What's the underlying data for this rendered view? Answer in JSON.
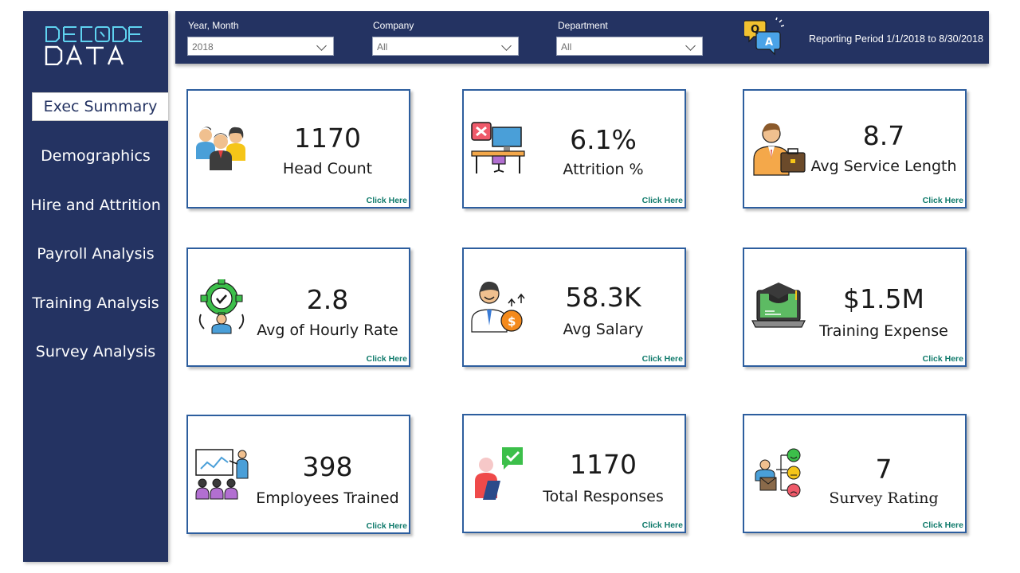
{
  "brand": {
    "logo_text_top": "DECODE",
    "logo_text_bottom": "DATA"
  },
  "sidebar": {
    "items": [
      {
        "label": "Exec Summary",
        "active": true
      },
      {
        "label": "Demographics"
      },
      {
        "label": "Hire and Attrition"
      },
      {
        "label": "Payroll Analysis"
      },
      {
        "label": "Training Analysis"
      },
      {
        "label": "Survey Analysis"
      }
    ]
  },
  "filters": {
    "year_month": {
      "label": "Year, Month",
      "value": "2018"
    },
    "company": {
      "label": "Company",
      "value": "All"
    },
    "department": {
      "label": "Department",
      "value": "All"
    }
  },
  "qa_icon": {
    "q": "Q",
    "a": "A"
  },
  "reporting_period": "Reporting Period 1/1/2018 to 8/30/2018",
  "cards": [
    {
      "value": "1170",
      "label": "Head Count",
      "link": "Click Here",
      "icon": "people-group-icon"
    },
    {
      "value": "6.1%",
      "label": "Attrition %",
      "link": "Click Here",
      "icon": "empty-desk-icon"
    },
    {
      "value": "8.7",
      "label": "Avg Service Length",
      "link": "Click Here",
      "icon": "employee-briefcase-icon"
    },
    {
      "value": "2.8",
      "label": "Avg of Hourly Rate",
      "link": "Click Here",
      "icon": "gear-clock-person-icon"
    },
    {
      "value": "58.3K",
      "label": "Avg Salary",
      "link": "Click Here",
      "icon": "employee-salary-icon"
    },
    {
      "value": "$1.5M",
      "label": "Training Expense",
      "link": "Click Here",
      "icon": "laptop-graduation-icon"
    },
    {
      "value": "398",
      "label": "Employees Trained",
      "link": "Click Here",
      "icon": "presentation-audience-icon"
    },
    {
      "value": "1170",
      "label": "Total Responses",
      "link": "Click Here",
      "icon": "survey-response-icon"
    },
    {
      "value": "7",
      "label": "Survey Rating",
      "link": "Click Here",
      "icon": "rating-faces-icon"
    }
  ],
  "colors": {
    "navy": "#243362",
    "card_border": "#2d5e9e",
    "link_green": "#0f7a6b"
  }
}
